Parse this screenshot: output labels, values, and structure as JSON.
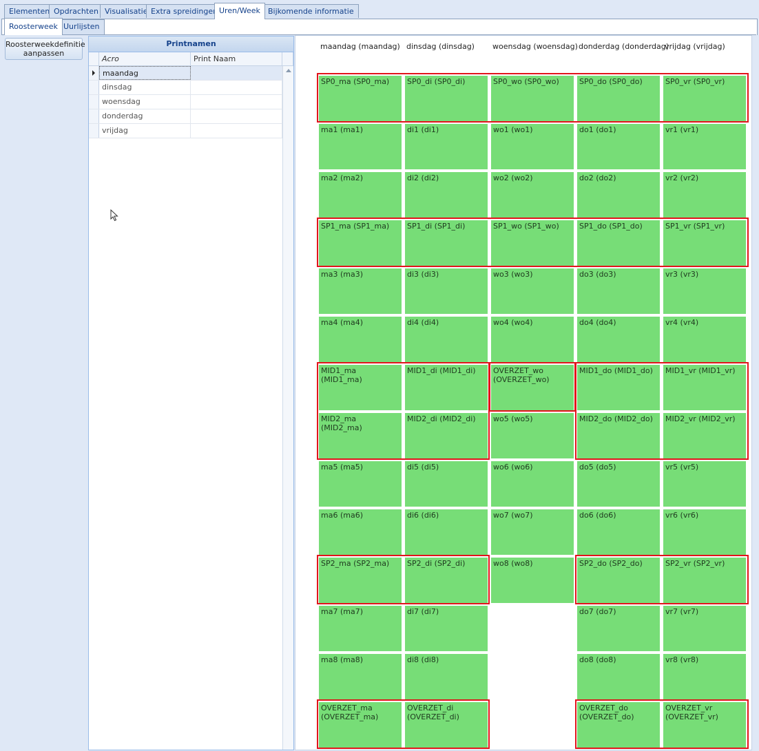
{
  "tabs_main": [
    {
      "label": "Elementen",
      "active": false
    },
    {
      "label": "Opdrachten",
      "active": false
    },
    {
      "label": "Visualisatie",
      "active": false
    },
    {
      "label": "Extra spreidingen",
      "active": false
    },
    {
      "label": "Uren/Week",
      "active": true
    },
    {
      "label": "Bijkomende informatie",
      "active": false
    }
  ],
  "tabs_sub": [
    {
      "label": "Roosterweek",
      "active": true
    },
    {
      "label": "Uurlijsten",
      "active": false
    }
  ],
  "button": {
    "label": "Roosterweekdefinitie aanpassen"
  },
  "printnamen": {
    "title": "Printnamen",
    "col_acro": "Acro",
    "col_print": "Print Naam",
    "rows": [
      {
        "acro": "maandag",
        "print": ""
      },
      {
        "acro": "dinsdag",
        "print": ""
      },
      {
        "acro": "woensdag",
        "print": ""
      },
      {
        "acro": "donderdag",
        "print": ""
      },
      {
        "acro": "vrijdag",
        "print": ""
      }
    ]
  },
  "days": [
    "maandag (maandag)",
    "dinsdag (dinsdag)",
    "woensdag (woensdag)",
    "donderdag (donderdag)",
    "vrijdag (vrijdag)"
  ],
  "schedule": [
    [
      "SP0_ma (SP0_ma)",
      "SP0_di (SP0_di)",
      "SP0_wo (SP0_wo)",
      "SP0_do (SP0_do)",
      "SP0_vr (SP0_vr)"
    ],
    [
      "ma1 (ma1)",
      "di1 (di1)",
      "wo1 (wo1)",
      "do1 (do1)",
      "vr1 (vr1)"
    ],
    [
      "ma2 (ma2)",
      "di2 (di2)",
      "wo2 (wo2)",
      "do2 (do2)",
      "vr2 (vr2)"
    ],
    [
      "SP1_ma (SP1_ma)",
      "SP1_di (SP1_di)",
      "SP1_wo (SP1_wo)",
      "SP1_do (SP1_do)",
      "SP1_vr (SP1_vr)"
    ],
    [
      "ma3 (ma3)",
      "di3 (di3)",
      "wo3 (wo3)",
      "do3 (do3)",
      "vr3 (vr3)"
    ],
    [
      "ma4 (ma4)",
      "di4 (di4)",
      "wo4 (wo4)",
      "do4 (do4)",
      "vr4 (vr4)"
    ],
    [
      "MID1_ma (MID1_ma)",
      "MID1_di (MID1_di)",
      "OVERZET_wo (OVERZET_wo)",
      "MID1_do (MID1_do)",
      "MID1_vr (MID1_vr)"
    ],
    [
      "MID2_ma (MID2_ma)",
      "MID2_di (MID2_di)",
      "wo5 (wo5)",
      "MID2_do (MID2_do)",
      "MID2_vr (MID2_vr)"
    ],
    [
      "ma5 (ma5)",
      "di5 (di5)",
      "wo6 (wo6)",
      "do5 (do5)",
      "vr5 (vr5)"
    ],
    [
      "ma6 (ma6)",
      "di6 (di6)",
      "wo7 (wo7)",
      "do6 (do6)",
      "vr6 (vr6)"
    ],
    [
      "SP2_ma (SP2_ma)",
      "SP2_di (SP2_di)",
      "wo8 (wo8)",
      "SP2_do (SP2_do)",
      "SP2_vr (SP2_vr)"
    ],
    [
      "ma7 (ma7)",
      "di7 (di7)",
      null,
      "do7 (do7)",
      "vr7 (vr7)"
    ],
    [
      "ma8 (ma8)",
      "di8 (di8)",
      null,
      "do8 (do8)",
      "vr8 (vr8)"
    ],
    [
      "OVERZET_ma (OVERZET_ma)",
      "OVERZET_di (OVERZET_di)",
      null,
      "OVERZET_do (OVERZET_do)",
      "OVERZET_vr (OVERZET_vr)"
    ]
  ],
  "colors": {
    "slot": "#77dd77",
    "highlight": "#e2141b",
    "tab_active": "#ffffff"
  }
}
